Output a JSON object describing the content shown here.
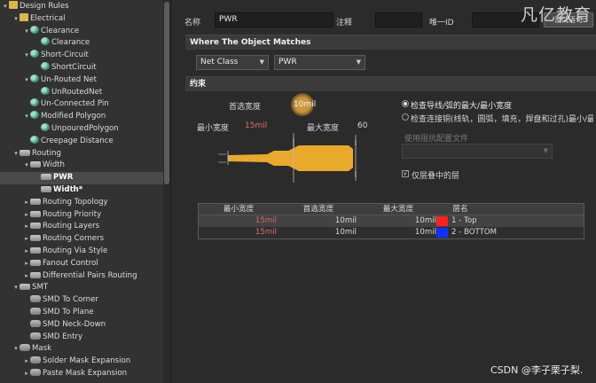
{
  "tree": {
    "items": [
      {
        "label": "Design Rules",
        "depth": 0,
        "icon": "folder",
        "arrow": "▾"
      },
      {
        "label": "Electrical",
        "depth": 1,
        "icon": "folder",
        "arrow": "▾"
      },
      {
        "label": "Clearance",
        "depth": 2,
        "icon": "rule",
        "arrow": "▾"
      },
      {
        "label": "Clearance",
        "depth": 3,
        "icon": "rule",
        "arrow": ""
      },
      {
        "label": "Short-Circuit",
        "depth": 2,
        "icon": "rule",
        "arrow": "▾"
      },
      {
        "label": "ShortCircuit",
        "depth": 3,
        "icon": "rule",
        "arrow": ""
      },
      {
        "label": "Un-Routed Net",
        "depth": 2,
        "icon": "rule",
        "arrow": "▾"
      },
      {
        "label": "UnRoutedNet",
        "depth": 3,
        "icon": "rule",
        "arrow": ""
      },
      {
        "label": "Un-Connected Pin",
        "depth": 2,
        "icon": "rule",
        "arrow": ""
      },
      {
        "label": "Modified Polygon",
        "depth": 2,
        "icon": "rule",
        "arrow": "▾"
      },
      {
        "label": "UnpouredPolygon",
        "depth": 3,
        "icon": "rule",
        "arrow": ""
      },
      {
        "label": "Creepage Distance",
        "depth": 2,
        "icon": "rule",
        "arrow": ""
      },
      {
        "label": "Routing",
        "depth": 1,
        "icon": "route",
        "arrow": "▾"
      },
      {
        "label": "Width",
        "depth": 2,
        "icon": "route",
        "arrow": "▾"
      },
      {
        "label": "PWR",
        "depth": 3,
        "icon": "route",
        "arrow": "",
        "selected": true,
        "bold": true
      },
      {
        "label": "Width*",
        "depth": 3,
        "icon": "route",
        "arrow": "",
        "bold": true
      },
      {
        "label": "Routing Topology",
        "depth": 2,
        "icon": "route",
        "arrow": "▸"
      },
      {
        "label": "Routing Priority",
        "depth": 2,
        "icon": "route",
        "arrow": "▸"
      },
      {
        "label": "Routing Layers",
        "depth": 2,
        "icon": "route",
        "arrow": "▸"
      },
      {
        "label": "Routing Corners",
        "depth": 2,
        "icon": "route",
        "arrow": "▸"
      },
      {
        "label": "Routing Via Style",
        "depth": 2,
        "icon": "route",
        "arrow": "▸"
      },
      {
        "label": "Fanout Control",
        "depth": 2,
        "icon": "route",
        "arrow": "▸"
      },
      {
        "label": "Differential Pairs Routing",
        "depth": 2,
        "icon": "route",
        "arrow": "▸"
      },
      {
        "label": "SMT",
        "depth": 1,
        "icon": "route",
        "arrow": "▾"
      },
      {
        "label": "SMD To Corner",
        "depth": 2,
        "icon": "mask",
        "arrow": ""
      },
      {
        "label": "SMD To Plane",
        "depth": 2,
        "icon": "mask",
        "arrow": ""
      },
      {
        "label": "SMD Neck-Down",
        "depth": 2,
        "icon": "mask",
        "arrow": ""
      },
      {
        "label": "SMD Entry",
        "depth": 2,
        "icon": "mask",
        "arrow": ""
      },
      {
        "label": "Mask",
        "depth": 1,
        "icon": "mask",
        "arrow": "▾"
      },
      {
        "label": "Solder Mask Expansion",
        "depth": 2,
        "icon": "mask",
        "arrow": "▸"
      },
      {
        "label": "Paste Mask Expansion",
        "depth": 2,
        "icon": "mask",
        "arrow": "▸"
      }
    ]
  },
  "header": {
    "name_label": "名称",
    "name_value": "PWR",
    "comment_label": "注释",
    "comment_value": "",
    "uid_label": "唯一ID",
    "uid_value": "",
    "test_button": "测试语句"
  },
  "where": {
    "title": "Where The Object Matches",
    "scope_value": "Net Class",
    "net_value": "PWR"
  },
  "constraints": {
    "title": "约束",
    "preferred_label": "首选宽度",
    "preferred_value": "10mil",
    "min_label": "最小宽度",
    "min_value": "15mil",
    "max_label": "最大宽度",
    "max_value": "60",
    "radio_1": "检查导线/弧的最大/最小宽度",
    "radio_2": "检查连接铜(线轨，圆弧，填充，焊盘和过孔)最小/最",
    "impedance_label": "使用阻抗配置文件",
    "impedance_value": "",
    "layer_stack_label": "仅层叠中的层",
    "layer_stack_mark": "√"
  },
  "table": {
    "headers": [
      "最小宽度",
      "首选宽度",
      "最大宽度",
      "层名"
    ],
    "rows": [
      {
        "min": "15mil",
        "pref": "10mil",
        "max": "10mil",
        "layer": "1 - Top",
        "color": "#ff2020"
      },
      {
        "min": "15mil",
        "pref": "10mil",
        "max": "10mil",
        "layer": "2 - BOTTOM",
        "color": "#1030ff"
      }
    ]
  },
  "watermark": "凡亿教育",
  "csdn": "CSDN @李子栗子梨."
}
